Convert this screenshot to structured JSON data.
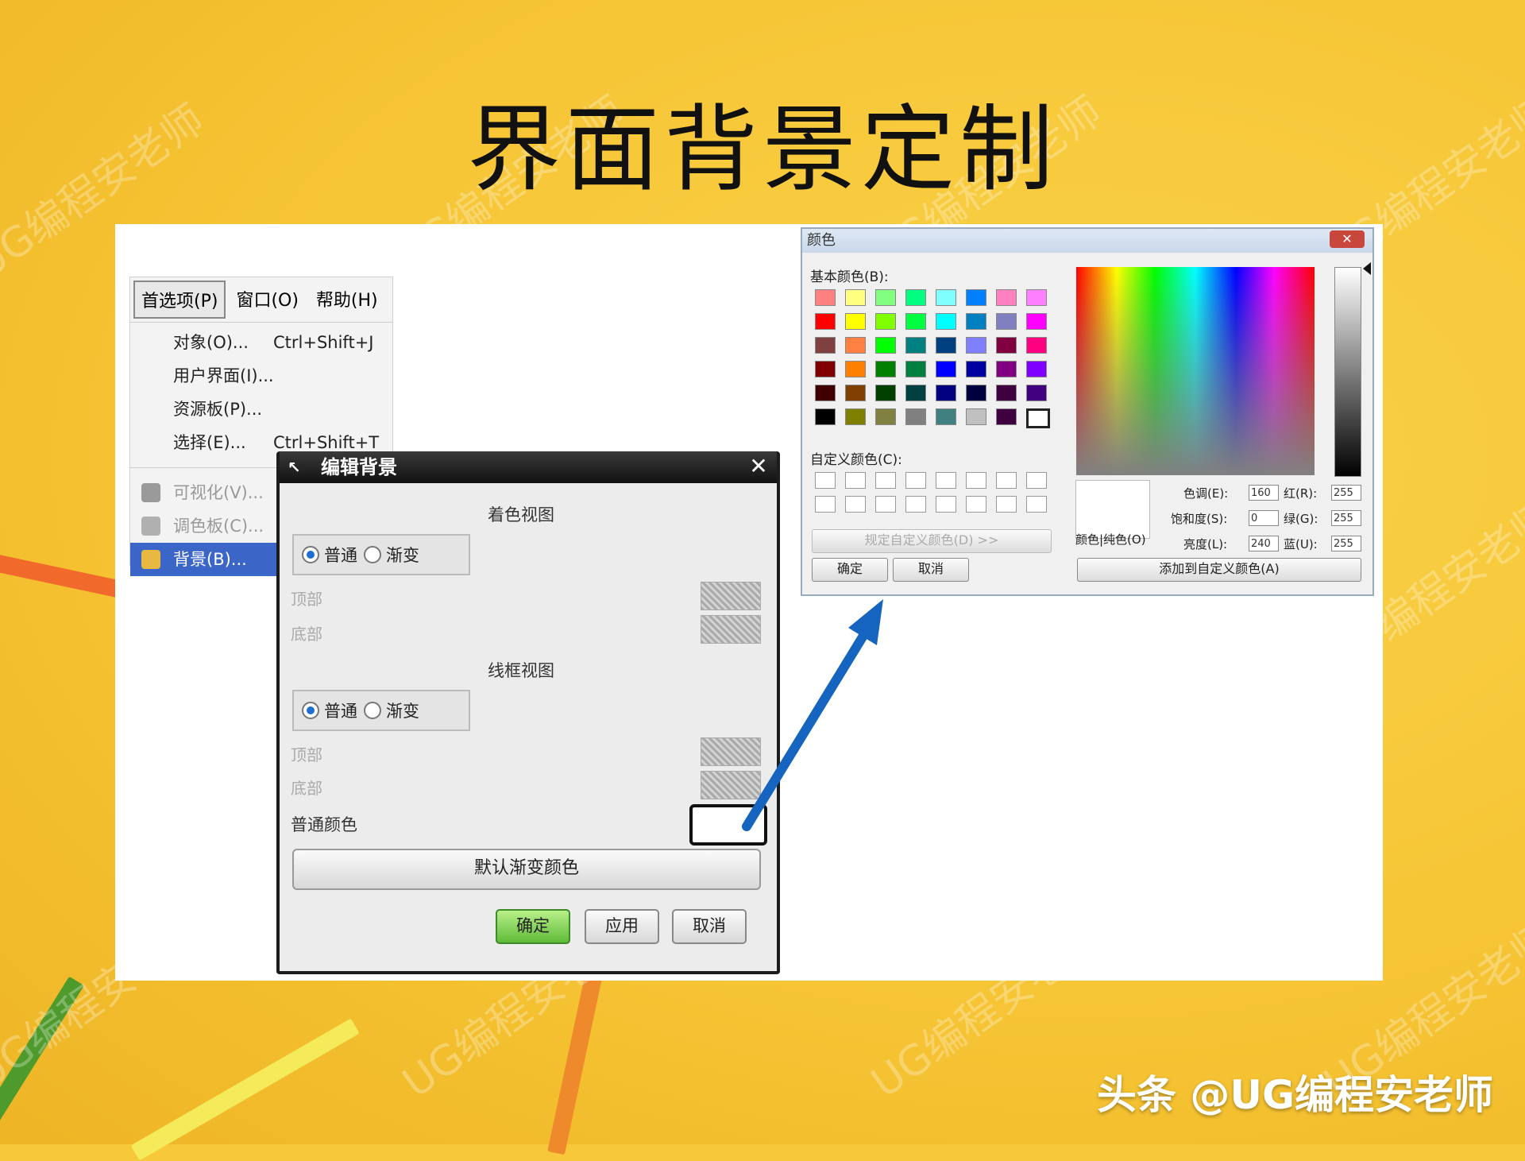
{
  "slide": {
    "title": "界面背景定制",
    "footer": "头条 @UG编程安老师",
    "watermark": "UG编程安老师"
  },
  "menu": {
    "menubar": [
      "首选项(P)",
      "窗口(O)",
      "帮助(H)"
    ],
    "items": [
      {
        "label": "对象(O)...",
        "shortcut": "Ctrl+Shift+J"
      },
      {
        "label": "用户界面(I)...",
        "shortcut": ""
      },
      {
        "label": "资源板(P)...",
        "shortcut": ""
      },
      {
        "label": "选择(E)...",
        "shortcut": "Ctrl+Shift+T"
      },
      {
        "label": "可视化(V)...",
        "shortcut": ""
      },
      {
        "label": "调色板(C)...",
        "shortcut": ""
      },
      {
        "label": "背景(B)...",
        "shortcut": ""
      }
    ]
  },
  "edit_bg": {
    "title": "编辑背景",
    "shaded_view": "着色视图",
    "wireframe_view": "线框视图",
    "plain": "普通",
    "gradient": "渐变",
    "top": "顶部",
    "bottom": "底部",
    "plain_color": "普通颜色",
    "default_gradient_btn": "默认渐变颜色",
    "ok": "确定",
    "apply": "应用",
    "cancel": "取消"
  },
  "color_dialog": {
    "title": "颜色",
    "basic_colors": "基本颜色(B):",
    "custom_colors": "自定义颜色(C):",
    "define_custom": "规定自定义颜色(D) >>",
    "ok": "确定",
    "cancel": "取消",
    "solid_label": "颜色|纯色(O)",
    "hue_label": "色调(E):",
    "hue": "160",
    "sat_label": "饱和度(S):",
    "sat": "0",
    "lum_label": "亮度(L):",
    "lum": "240",
    "red_label": "红(R):",
    "red": "255",
    "green_label": "绿(G):",
    "green": "255",
    "blue_label": "蓝(U):",
    "blue": "255",
    "add_custom": "添加到自定义颜色(A)",
    "palette": [
      [
        "#ff8080",
        "#ffff80",
        "#80ff80",
        "#00ff80",
        "#80ffff",
        "#0080ff",
        "#ff80c0",
        "#ff80ff"
      ],
      [
        "#ff0000",
        "#ffff00",
        "#80ff00",
        "#00ff40",
        "#00ffff",
        "#0080c0",
        "#8080c0",
        "#ff00ff"
      ],
      [
        "#804040",
        "#ff8040",
        "#00ff00",
        "#008080",
        "#004080",
        "#8080ff",
        "#800040",
        "#ff0080"
      ],
      [
        "#800000",
        "#ff8000",
        "#008000",
        "#008040",
        "#0000ff",
        "#0000a0",
        "#800080",
        "#8000ff"
      ],
      [
        "#400000",
        "#804000",
        "#004000",
        "#004040",
        "#000080",
        "#000040",
        "#400040",
        "#400080"
      ],
      [
        "#000000",
        "#808000",
        "#808040",
        "#808080",
        "#408080",
        "#c0c0c0",
        "#400040",
        "#ffffff"
      ]
    ]
  },
  "colors": {
    "accent_blue": "#1565c0",
    "selected_menu": "#3b66c8",
    "ok_green": "#5fbb38",
    "slide_bg": "#f7c93a"
  }
}
